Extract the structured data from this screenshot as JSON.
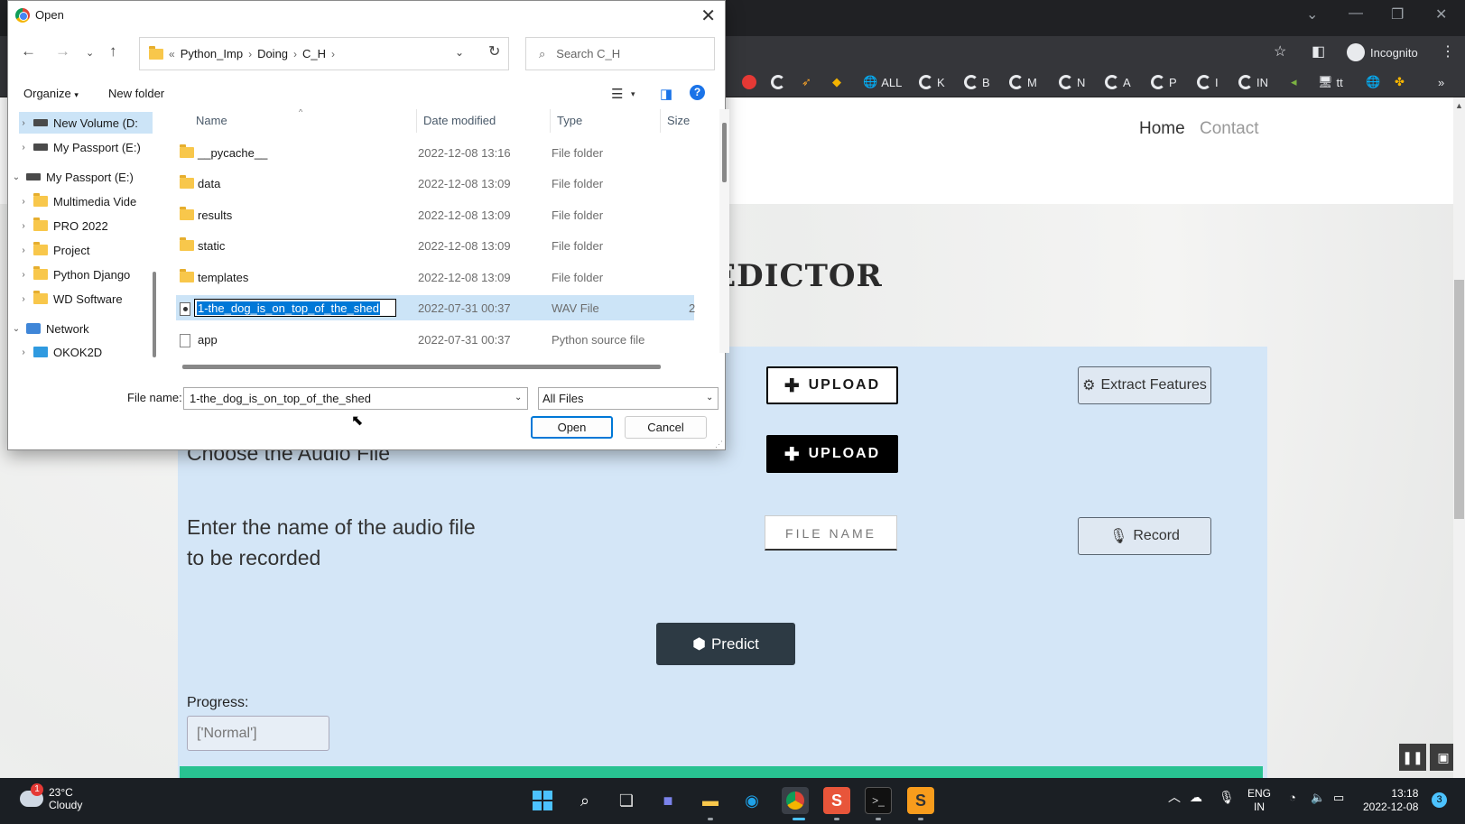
{
  "browser": {
    "profile_label": "Incognito",
    "bookmarks": [
      "ALL",
      "K",
      "B",
      "M",
      "N",
      "A",
      "P",
      "I",
      "IN",
      "tt"
    ]
  },
  "page": {
    "nav": {
      "home": "Home",
      "contact": "Contact"
    },
    "title_partial": "REDICTOR",
    "upload_label": "UPLOAD",
    "extract_label": "Extract Features",
    "choose_audio_label": "Choose the Audio File",
    "record_prompt_line1": "Enter the name of the audio file",
    "record_prompt_line2": "to be recorded",
    "filename_placeholder": "FILE NAME",
    "record_label": "Record",
    "predict_label": "Predict",
    "progress_label": "Progress:",
    "progress_value": "['Normal']"
  },
  "dialog": {
    "title": "Open",
    "breadcrumb": [
      "Python_Imp",
      "Doing",
      "C_H"
    ],
    "breadcrumb_prefix": "«",
    "search_placeholder": "Search C_H",
    "organize_label": "Organize",
    "new_folder_label": "New folder",
    "nav_tree": [
      {
        "label": "New Volume (D:",
        "icon": "drive-icon",
        "expanded": false,
        "selected": true
      },
      {
        "label": "My Passport (E:)",
        "icon": "drive-icon",
        "expanded": false
      },
      {
        "label": "My Passport (E:)",
        "icon": "drive-icon",
        "expanded": true
      },
      {
        "label": "Multimedia Vide",
        "icon": "folder-icon",
        "expanded": false
      },
      {
        "label": "PRO 2022",
        "icon": "folder-icon",
        "expanded": false
      },
      {
        "label": "Project",
        "icon": "folder-icon",
        "expanded": false
      },
      {
        "label": "Python Django",
        "icon": "folder-icon",
        "expanded": false
      },
      {
        "label": "WD Software",
        "icon": "folder-icon",
        "expanded": false
      },
      {
        "label": "Network",
        "icon": "network-icon",
        "expanded": true
      },
      {
        "label": "OKOK2D",
        "icon": "computer-icon",
        "expanded": false
      }
    ],
    "columns": {
      "name": "Name",
      "date": "Date modified",
      "type": "Type",
      "size": "Size"
    },
    "files": [
      {
        "name": "__pycache__",
        "date": "2022-12-08 13:16",
        "type": "File folder",
        "size": ""
      },
      {
        "name": "data",
        "date": "2022-12-08 13:09",
        "type": "File folder",
        "size": ""
      },
      {
        "name": "results",
        "date": "2022-12-08 13:09",
        "type": "File folder",
        "size": ""
      },
      {
        "name": "static",
        "date": "2022-12-08 13:09",
        "type": "File folder",
        "size": ""
      },
      {
        "name": "templates",
        "date": "2022-12-08 13:09",
        "type": "File folder",
        "size": ""
      },
      {
        "name": "1-the_dog_is_on_top_of_the_shed",
        "date": "2022-07-31 00:37",
        "type": "WAV File",
        "size": "2"
      },
      {
        "name": "app",
        "date": "2022-07-31 00:37",
        "type": "Python source file",
        "size": ""
      }
    ],
    "file_name_label": "File name:",
    "file_name_value": "1-the_dog_is_on_top_of_the_shed",
    "file_type_value": "All Files",
    "open_label": "Open",
    "cancel_label": "Cancel"
  },
  "taskbar": {
    "weather_temp": "23°C",
    "weather_desc": "Cloudy",
    "weather_badge": "1",
    "lang_line1": "ENG",
    "lang_line2": "IN",
    "time": "13:18",
    "date": "2022-12-08",
    "notif_count": "3"
  }
}
